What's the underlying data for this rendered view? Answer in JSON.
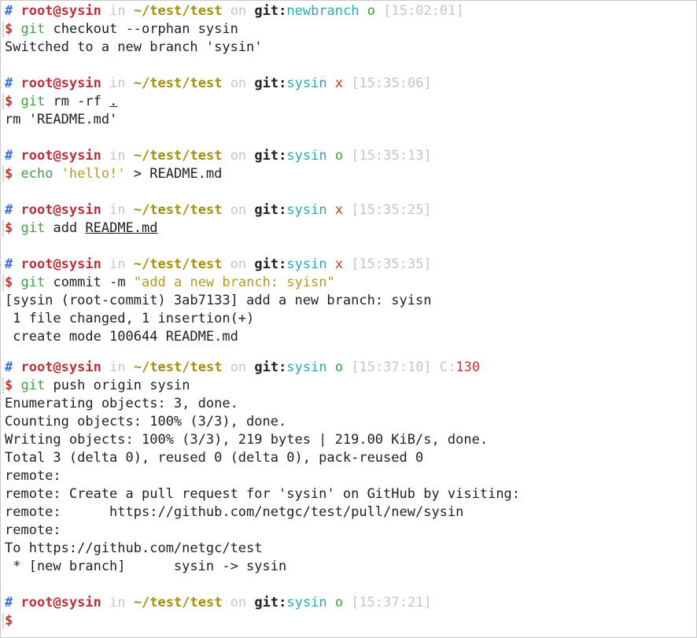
{
  "prompt": {
    "hash": "#",
    "user": "root@sysin",
    "in": "in",
    "dir": "~/test/test",
    "on": "on",
    "git_label": "git:",
    "dollar": "$"
  },
  "blocks": [
    {
      "branch": "newbranch",
      "status": "o",
      "time": "[15:02:01]",
      "cmd": "git",
      "args": " checkout --orphan sysin",
      "output": [
        "Switched to a new branch 'sysin'"
      ]
    },
    {
      "branch": "sysin",
      "status": "x",
      "time": "[15:35:06]",
      "cmd": "git",
      "args": " rm -rf ",
      "arg_underlined": ".",
      "output": [
        "rm 'README.md'"
      ]
    },
    {
      "branch": "sysin",
      "status": "o",
      "time": "[15:35:13]",
      "cmd": "echo",
      "args_str": " 'hello!'",
      "args_rest": " > README.md",
      "output": []
    },
    {
      "branch": "sysin",
      "status": "x",
      "time": "[15:35:25]",
      "cmd": "git",
      "args": " add ",
      "arg_underlined": "README.md",
      "output": []
    },
    {
      "branch": "sysin",
      "status": "x",
      "time": "[15:35:35]",
      "cmd": "git",
      "args": " commit -m ",
      "args_str": "\"add a new branch: syisn\"",
      "output": [
        "[sysin (root-commit) 3ab7133] add a new branch: syisn",
        " 1 file changed, 1 insertion(+)",
        " create mode 100644 README.md"
      ]
    },
    {
      "branch": "sysin",
      "status": "o",
      "time": "[15:37:10]",
      "exit_label": "C:",
      "exit_code": "130",
      "cmd": "git",
      "args": " push origin sysin",
      "output": [
        "Enumerating objects: 3, done.",
        "Counting objects: 100% (3/3), done.",
        "Writing objects: 100% (3/3), 219 bytes | 219.00 KiB/s, done.",
        "Total 3 (delta 0), reused 0 (delta 0), pack-reused 0",
        "remote:",
        "remote: Create a pull request for 'sysin' on GitHub by visiting:",
        "remote:      https://github.com/netgc/test/pull/new/sysin",
        "remote:",
        "To https://github.com/netgc/test",
        " * [new branch]      sysin -> sysin"
      ]
    },
    {
      "branch": "sysin",
      "status": "o",
      "time": "[15:37:21]",
      "output": []
    }
  ],
  "colors": {
    "hash": "#3a6fd8",
    "user": "#b8323a",
    "dir": "#a58f12",
    "branch": "#2aa7b8",
    "clean": "#3fa03f",
    "dirty": "#c4372c",
    "dim": "#c5c5c5"
  }
}
